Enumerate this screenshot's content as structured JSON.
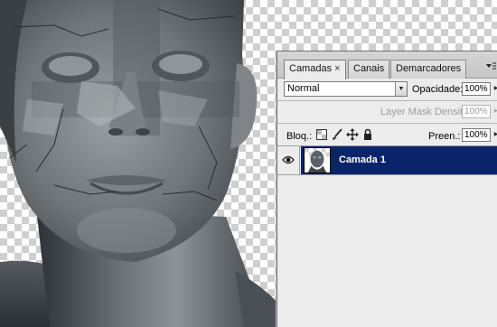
{
  "panel": {
    "tabs": [
      {
        "label": "Camadas",
        "close": "×",
        "active": true
      },
      {
        "label": "Canais",
        "active": false
      },
      {
        "label": "Demarcadores",
        "active": false
      }
    ],
    "blend_mode": {
      "value": "Normal"
    },
    "opacity": {
      "label": "Opacidade:",
      "value": "100%"
    },
    "mask_density": {
      "label": "Layer Mask Density",
      "value": "100%"
    },
    "lock": {
      "label": "Bloq.:"
    },
    "fill": {
      "label": "Preen.:",
      "value": "100%"
    },
    "layers": [
      {
        "name": "Camada 1",
        "visible": true,
        "selected": true
      }
    ]
  },
  "icons": {
    "tab_close": "close-icon",
    "panel_menu": "panel-menu-icon",
    "dropdown": "chevron-down-icon",
    "spin": "chevron-right-icon",
    "lock_transparent": "lock-transparent-pixels-icon",
    "lock_image": "brush-icon",
    "lock_position": "move-icon",
    "lock_all": "padlock-icon",
    "visibility": "eye-icon"
  },
  "colors": {
    "selected_layer": "#0a246a",
    "panel_bg": "#ececec",
    "disabled_text": "#9c9c9c"
  }
}
